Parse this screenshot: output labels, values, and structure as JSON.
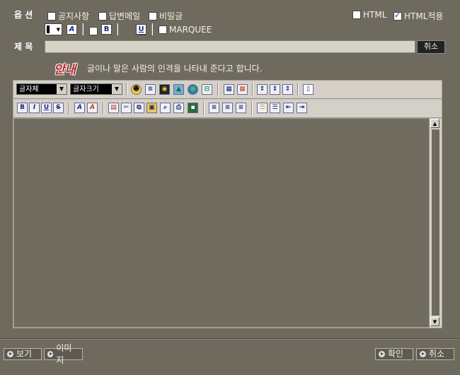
{
  "labels": {
    "options": "옵 션",
    "subject": "제 목"
  },
  "options": {
    "notice": {
      "label": "공지사항",
      "checked": false
    },
    "reply_mail": {
      "label": "답변메일",
      "checked": false
    },
    "secret": {
      "label": "비밀글",
      "checked": false
    },
    "html": {
      "label": "HTML",
      "checked": false
    },
    "html_apply": {
      "label": "HTML적용",
      "checked": true
    },
    "marquee": {
      "label": "MARQUEE",
      "checked": false
    }
  },
  "subject": {
    "value": "",
    "cancel_label": "취소"
  },
  "guide": {
    "badge": "안내",
    "text": "글이나 말은 사람의 인격을 나타내 준다고 합니다."
  },
  "editor_toolbar": {
    "font_face": "글자체",
    "font_size": "글자크기",
    "bold": "B",
    "italic": "I",
    "underline": "U",
    "strike": "S"
  },
  "editor": {
    "content": ""
  },
  "bottom": {
    "preview": "보기",
    "image": "이미지",
    "confirm": "확인",
    "cancel": "취소"
  }
}
